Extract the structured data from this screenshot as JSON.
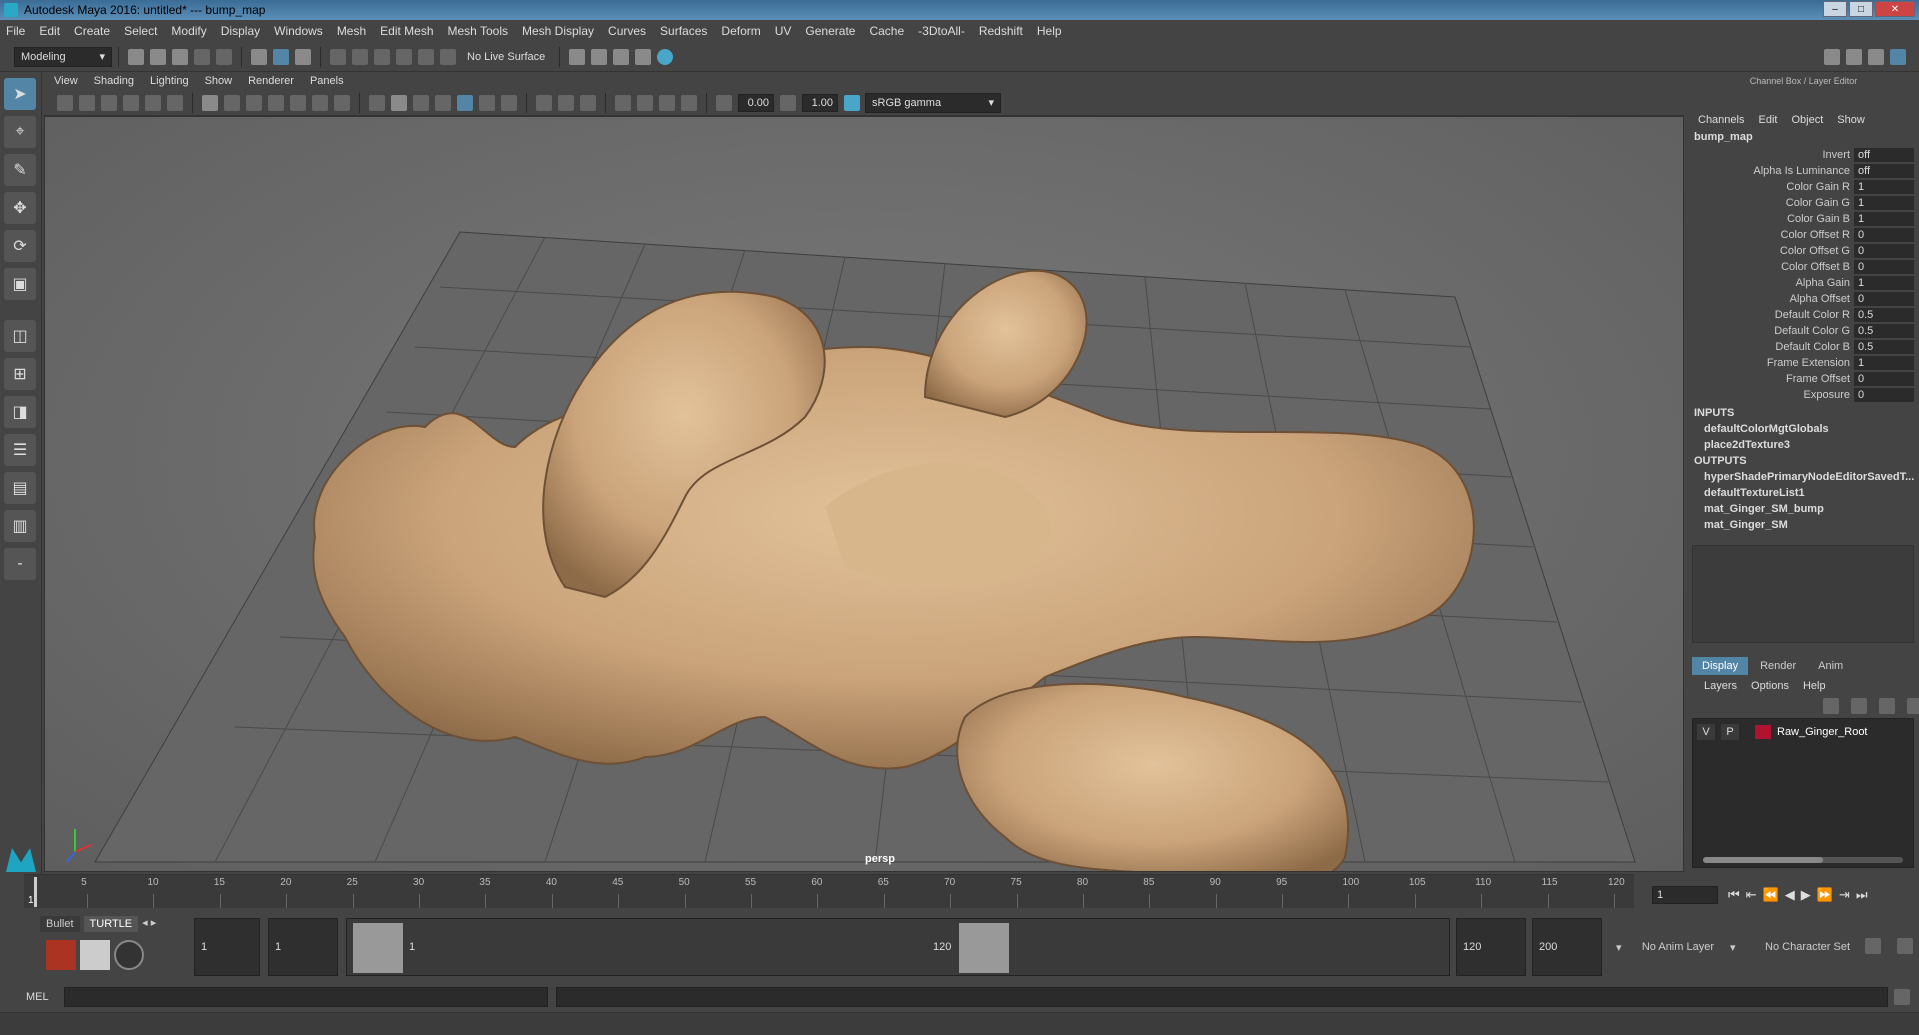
{
  "window": {
    "title": "Autodesk Maya 2016: untitled*   ---   bump_map"
  },
  "menubar": [
    "File",
    "Edit",
    "Create",
    "Select",
    "Modify",
    "Display",
    "Windows",
    "Mesh",
    "Edit Mesh",
    "Mesh Tools",
    "Mesh Display",
    "Curves",
    "Surfaces",
    "Deform",
    "UV",
    "Generate",
    "Cache",
    "-3DtoAll-",
    "Redshift",
    "Help"
  ],
  "statusline": {
    "mode": "Modeling",
    "live_surface": "No Live Surface"
  },
  "viewport": {
    "menu": [
      "View",
      "Shading",
      "Lighting",
      "Show",
      "Renderer",
      "Panels"
    ],
    "exposure": "0.00",
    "gamma": "1.00",
    "colorspace": "sRGB gamma",
    "camera": "persp"
  },
  "channelbox": {
    "header": "Channel Box / Layer Editor",
    "tabs": [
      "Channels",
      "Edit",
      "Object",
      "Show"
    ],
    "node": "bump_map",
    "attributes": [
      {
        "name": "Invert",
        "value": "off"
      },
      {
        "name": "Alpha Is Luminance",
        "value": "off"
      },
      {
        "name": "Color Gain R",
        "value": "1"
      },
      {
        "name": "Color Gain G",
        "value": "1"
      },
      {
        "name": "Color Gain B",
        "value": "1"
      },
      {
        "name": "Color Offset R",
        "value": "0"
      },
      {
        "name": "Color Offset G",
        "value": "0"
      },
      {
        "name": "Color Offset B",
        "value": "0"
      },
      {
        "name": "Alpha Gain",
        "value": "1"
      },
      {
        "name": "Alpha Offset",
        "value": "0"
      },
      {
        "name": "Default Color R",
        "value": "0.5"
      },
      {
        "name": "Default Color G",
        "value": "0.5"
      },
      {
        "name": "Default Color B",
        "value": "0.5"
      },
      {
        "name": "Frame Extension",
        "value": "1"
      },
      {
        "name": "Frame Offset",
        "value": "0"
      },
      {
        "name": "Exposure",
        "value": "0"
      }
    ],
    "inputs_label": "INPUTS",
    "inputs": [
      "defaultColorMgtGlobals",
      "place2dTexture3"
    ],
    "outputs_label": "OUTPUTS",
    "outputs": [
      "hyperShadePrimaryNodeEditorSavedT...",
      "defaultTextureList1",
      "mat_Ginger_SM_bump",
      "mat_Ginger_SM"
    ]
  },
  "layereditor": {
    "tabs": [
      "Display",
      "Render",
      "Anim"
    ],
    "menu": [
      "Layers",
      "Options",
      "Help"
    ],
    "layer": {
      "v": "V",
      "p": "P",
      "name": "Raw_Ginger_Root",
      "color": "#b01230"
    }
  },
  "timeslider": {
    "ticks": [
      "5",
      "10",
      "15",
      "20",
      "25",
      "30",
      "35",
      "40",
      "45",
      "50",
      "55",
      "60",
      "65",
      "70",
      "75",
      "80",
      "85",
      "90",
      "95",
      "100",
      "105",
      "110",
      "115",
      "120"
    ],
    "start_label": "1",
    "current_frame": "1"
  },
  "range": {
    "shelf_tabs": [
      "Bullet",
      "TURTLE"
    ],
    "start_anim": "1",
    "start_play": "1",
    "range_start": "1",
    "range_end": "120",
    "end_play": "120",
    "end_anim": "200",
    "anim_layer": "No Anim Layer",
    "character_set": "No Character Set"
  },
  "cmdline": {
    "label": "MEL"
  }
}
